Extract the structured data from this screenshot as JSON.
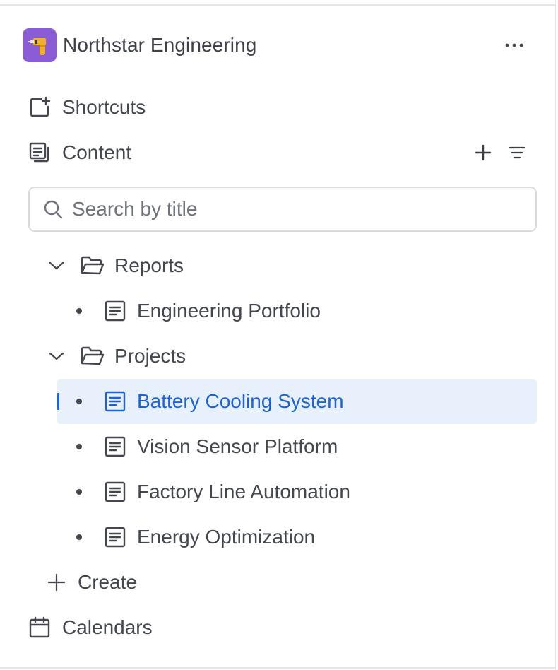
{
  "space": {
    "name": "Northstar Engineering",
    "avatar_icon": "drill-icon",
    "avatar_color": "#8a5cd6",
    "more_icon": "more-horizontal-icon"
  },
  "nav": {
    "shortcuts_label": "Shortcuts",
    "content_label": "Content",
    "calendars_label": "Calendars"
  },
  "search": {
    "placeholder": "Search by title",
    "value": ""
  },
  "tree": {
    "folders": [
      {
        "label": "Reports",
        "expanded": true,
        "pages": [
          {
            "label": "Engineering Portfolio",
            "selected": false
          }
        ]
      },
      {
        "label": "Projects",
        "expanded": true,
        "pages": [
          {
            "label": "Battery Cooling System",
            "selected": true
          },
          {
            "label": "Vision Sensor Platform",
            "selected": false
          },
          {
            "label": "Factory Line Automation",
            "selected": false
          },
          {
            "label": "Energy Optimization",
            "selected": false
          }
        ]
      }
    ]
  },
  "create_label": "Create",
  "colors": {
    "accent": "#1d63d8",
    "selected_bg": "#e8f0fc",
    "text": "#44474f"
  }
}
